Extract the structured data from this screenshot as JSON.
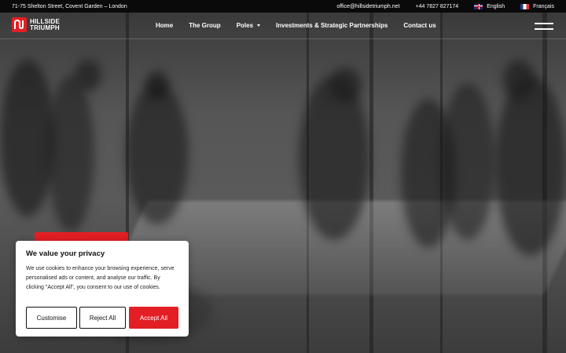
{
  "topbar": {
    "address": "71-75 Shelton Street, Covent Garden – London",
    "email": "office@hillsidetriumph.net",
    "phone": "+44 7827 827174",
    "lang_en": "English",
    "lang_fr": "Français"
  },
  "logo": {
    "line1": "HILLSIDE",
    "line2": "TRIUMPH"
  },
  "nav": {
    "home": "Home",
    "group": "The Group",
    "poles": "Poles",
    "investments": "Investments & Strategic Partnerships",
    "contact": "Contact us"
  },
  "cookie": {
    "title": "We value your privacy",
    "body": "We use cookies to enhance your browsing experience, serve personalised ads or content, and analyse our traffic. By clicking \"Accept All\", you consent to our use of cookies.",
    "customise": "Customise",
    "reject": "Reject All",
    "accept": "Accept All"
  },
  "colors": {
    "accent": "#e31e24",
    "topbar": "#0a0a0a"
  }
}
